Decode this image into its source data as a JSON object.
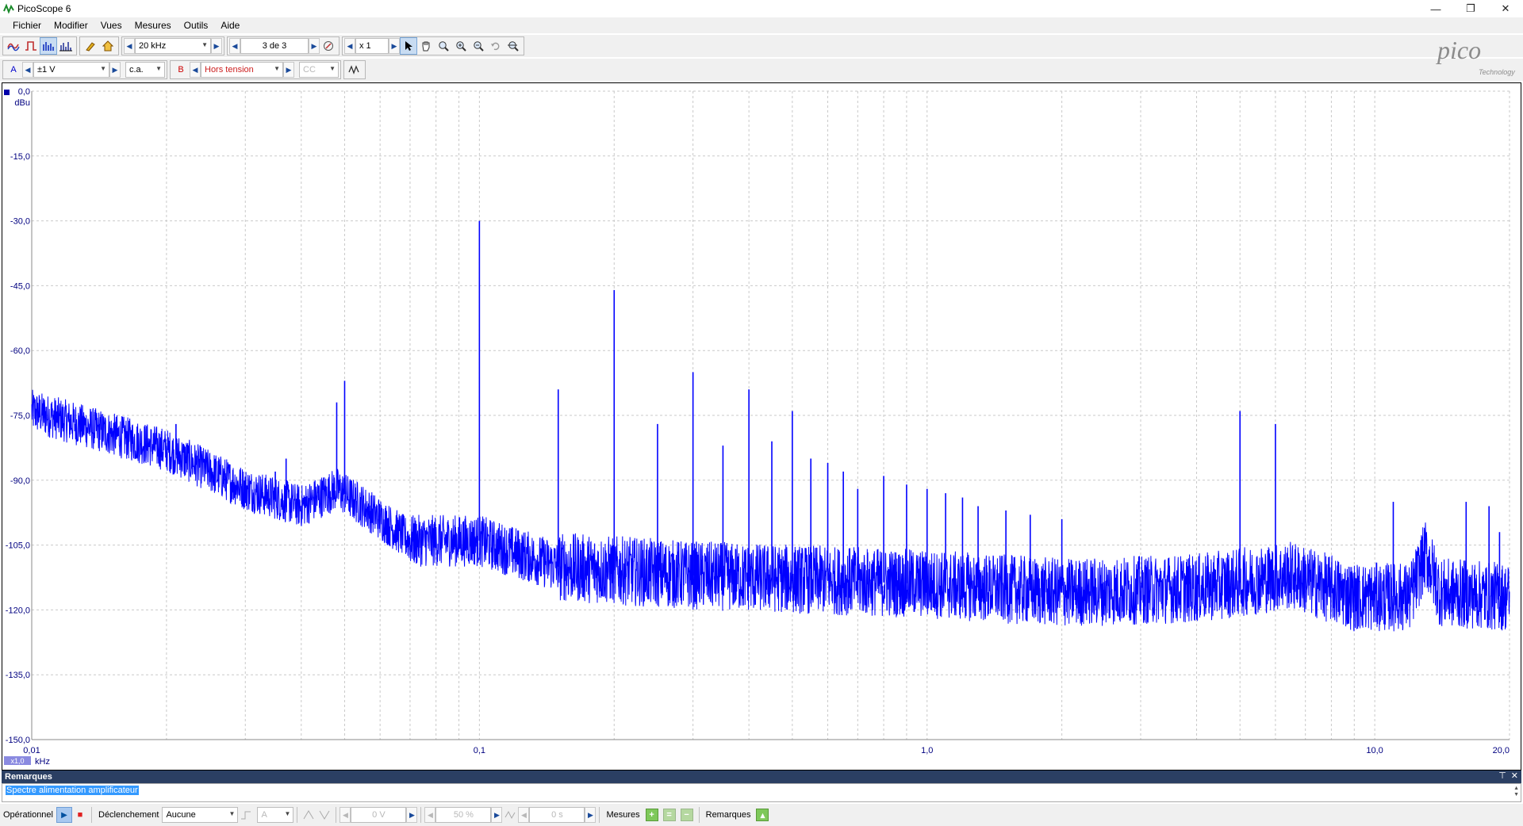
{
  "window": {
    "title": "PicoScope 6",
    "controls": [
      "—",
      "❐",
      "✕"
    ]
  },
  "menu": [
    "Fichier",
    "Modifier",
    "Vues",
    "Mesures",
    "Outils",
    "Aide"
  ],
  "toolbar1": {
    "timebase": "20 kHz",
    "buffer": "3 de 3",
    "zoom": "x 1"
  },
  "toolbar2": {
    "channel_a": {
      "label": "A",
      "range": "±1 V",
      "coupling": "c.a."
    },
    "channel_b": {
      "label": "B",
      "range": "Hors tension",
      "coupling": "CC"
    }
  },
  "logo": {
    "brand": "pico",
    "sub": "Technology"
  },
  "accent": "#0000ff",
  "chart_data": {
    "type": "line",
    "ylabel": "dBu",
    "xlabel": "kHz",
    "x_scale": "log",
    "xlim": [
      0.01,
      20.0
    ],
    "ylim": [
      -150,
      0
    ],
    "x_ticks": [
      "0,01",
      "0,1",
      "1,0",
      "10,0",
      "20,0"
    ],
    "y_ticks": [
      "0,0",
      "-15,0",
      "-30,0",
      "-45,0",
      "-60,0",
      "-75,0",
      "-90,0",
      "-105,0",
      "-120,0",
      "-135,0",
      "-150,0"
    ],
    "grid": true,
    "x_zoom_badge": "x1,0",
    "series": [
      {
        "color": "#0000ff",
        "noise_floor": [
          [
            0.01,
            -74
          ],
          [
            0.02,
            -83
          ],
          [
            0.03,
            -92
          ],
          [
            0.04,
            -96
          ],
          [
            0.048,
            -92
          ],
          [
            0.055,
            -96
          ],
          [
            0.07,
            -104
          ],
          [
            0.1,
            -104
          ],
          [
            0.15,
            -110
          ],
          [
            0.3,
            -112
          ],
          [
            1.0,
            -114
          ],
          [
            2.0,
            -116
          ],
          [
            4.0,
            -115
          ],
          [
            6.5,
            -112
          ],
          [
            9.0,
            -117
          ],
          [
            12.0,
            -117
          ],
          [
            13.0,
            -107
          ],
          [
            14.0,
            -116
          ],
          [
            20.0,
            -117
          ]
        ],
        "peaks": [
          [
            0.1,
            -30
          ],
          [
            0.2,
            -46
          ],
          [
            0.15,
            -69
          ],
          [
            0.05,
            -67
          ],
          [
            0.048,
            -72
          ],
          [
            0.25,
            -77
          ],
          [
            0.3,
            -65
          ],
          [
            0.35,
            -82
          ],
          [
            0.4,
            -69
          ],
          [
            0.45,
            -81
          ],
          [
            0.5,
            -74
          ],
          [
            0.55,
            -85
          ],
          [
            0.6,
            -86
          ],
          [
            0.65,
            -88
          ],
          [
            0.7,
            -92
          ],
          [
            0.8,
            -89
          ],
          [
            0.9,
            -91
          ],
          [
            1.0,
            -92
          ],
          [
            1.1,
            -93
          ],
          [
            1.2,
            -94
          ],
          [
            1.3,
            -96
          ],
          [
            1.5,
            -97
          ],
          [
            1.7,
            -98
          ],
          [
            2.0,
            -99
          ],
          [
            5.0,
            -74
          ],
          [
            6.0,
            -77
          ],
          [
            11.0,
            -95
          ],
          [
            16.0,
            -95
          ],
          [
            18.0,
            -96
          ],
          [
            19.0,
            -102
          ],
          [
            0.021,
            -77
          ],
          [
            0.027,
            -90
          ],
          [
            0.035,
            -88
          ],
          [
            0.037,
            -85
          ]
        ]
      }
    ]
  },
  "remarks": {
    "header": "Remarques",
    "header_icons": [
      "⊤",
      "✕"
    ],
    "text": "Spectre alimentation amplificateur"
  },
  "status": {
    "mode": "Opérationnel",
    "trigger_label": "Déclenchement",
    "trigger_type": "Aucune",
    "trigger_channel": "A",
    "trigger_level": "0 V",
    "pretrigger": "50 %",
    "delay": "0 s",
    "measurements": "Mesures",
    "notes": "Remarques"
  }
}
